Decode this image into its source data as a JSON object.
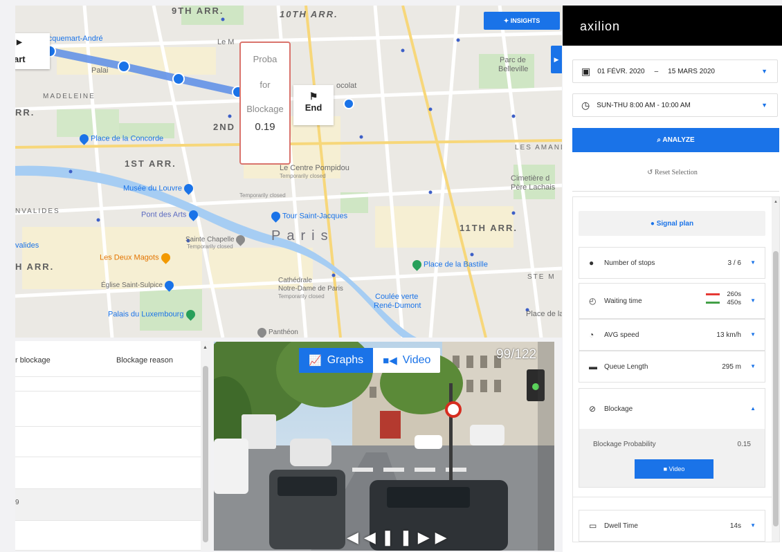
{
  "map": {
    "insights_label": "INSIGHTS",
    "start_label": "art",
    "end_label": "End",
    "proba_card": {
      "line1": "Proba",
      "line2": "for",
      "line3": "Blockage",
      "value": "0.19"
    },
    "arrondissements": [
      "9TH ARR.",
      "10TH ARR.",
      "2ND",
      "1ST ARR.",
      "11TH ARR.",
      "RR.",
      "H ARR.",
      "MADELEINE",
      "NVALIDES",
      "LES AMAND",
      "STE M"
    ],
    "city_label": "Paris",
    "places": {
      "jacquemart": "e Jacquemart-André",
      "concorde": "Place de la Concorde",
      "louvre": "Musée du Louvre",
      "pont_arts": "Pont des Arts",
      "chapelle": "Sainte Chapelle",
      "chapelle_note": "Temporarily closed",
      "deux_magots": "Les Deux Magots",
      "saint_sulpice": "Église Saint-Sulpice",
      "luxembourg": "Palais du Luxembourg",
      "pantheon": "Panthéon",
      "notre_dame_1": "Cathédrale",
      "notre_dame_2": "Notre-Dame de Paris",
      "notre_dame_note": "Temporarily closed",
      "tour_st_jacques": "Tour Saint-Jacques",
      "pompidou": "Le Centre Pompidou",
      "pompidou_note": "Temporarily closed",
      "bastille": "Place de la Bastille",
      "coulee_1": "Coulée verte",
      "coulee_2": "René-Dumont",
      "belleville_1": "Parc de",
      "belleville_2": "Belleville",
      "pere_lachaise_1": "Cimetière d",
      "pere_lachaise_2": "Père Lachais",
      "place_de_la": "Place de la",
      "chocolat": "ocolat",
      "le_m": "Le M",
      "palai": "Palai",
      "invalides": "valides",
      "route_closed": "Temporarily closed"
    }
  },
  "table": {
    "headers": [
      "r blockage",
      "Blockage reason"
    ],
    "rows": [
      "",
      "",
      "",
      "",
      "9",
      ""
    ]
  },
  "video": {
    "tabs": [
      {
        "label": "Graphs",
        "icon": "chart-icon"
      },
      {
        "label": "Video",
        "icon": "video-camera-icon"
      }
    ],
    "frame_counter": "99/122"
  },
  "sidebar": {
    "logo": "axilion",
    "date_range": {
      "from": "01 FÉVR. 2020",
      "sep": "–",
      "to": "15 MARS 2020"
    },
    "time_range": "SUN-THU 8:00 AM - 10:00 AM",
    "analyze_label": "ANALYZE",
    "reset_label": "Reset Selection",
    "signal_plan_label": "Signal plan",
    "metrics": {
      "stops": {
        "label": "Number of stops",
        "value": "3 / 6"
      },
      "waiting": {
        "label": "Waiting time",
        "value_red": "260s",
        "value_green": "450s"
      },
      "speed": {
        "label": "AVG speed",
        "value": "13 km/h"
      },
      "queue": {
        "label": "Queue Length",
        "value": "295 m"
      },
      "dwell": {
        "label": "Dwell Time",
        "value": "14s"
      }
    },
    "blockage": {
      "label": "Blockage",
      "prob_label": "Blockage Probability",
      "prob_value": "0.15",
      "video_label": "Video"
    }
  },
  "colors": {
    "accent": "#1a73e8",
    "route": "#5b8de8",
    "card_border": "#d9736c",
    "wait_red": "#e53935",
    "wait_green": "#43a047"
  }
}
